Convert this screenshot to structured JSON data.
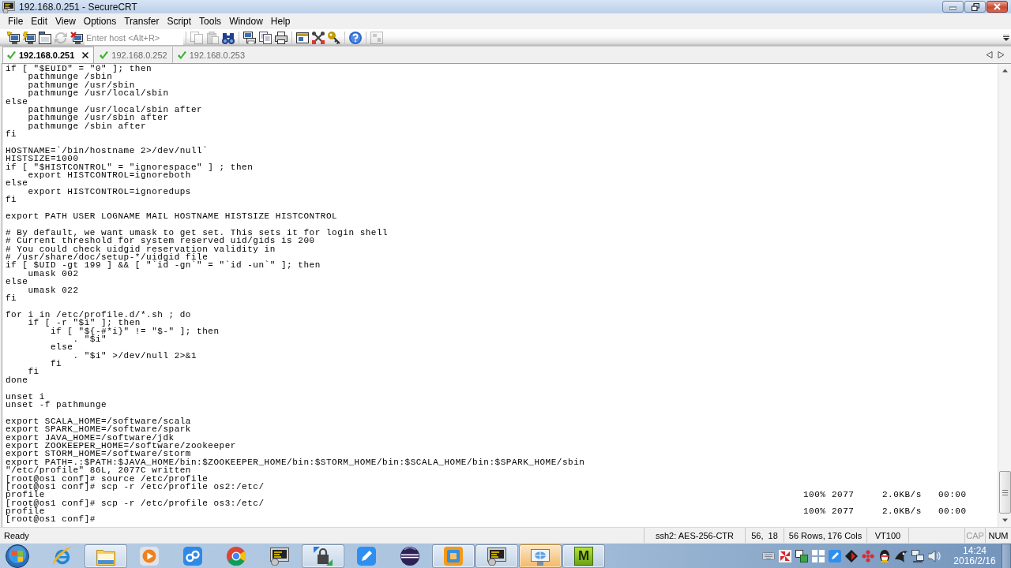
{
  "window": {
    "title": "192.168.0.251 - SecureCRT"
  },
  "menu": [
    "File",
    "Edit",
    "View",
    "Options",
    "Transfer",
    "Script",
    "Tools",
    "Window",
    "Help"
  ],
  "toolbar": {
    "connection_buttons": [
      {
        "kind": "connect",
        "disabled": false
      },
      {
        "kind": "quick",
        "disabled": false
      },
      {
        "kind": "tab",
        "disabled": false
      },
      {
        "kind": "reconnect",
        "disabled": true
      },
      {
        "kind": "disconnect",
        "disabled": false
      }
    ],
    "host_field": {
      "placeholder": "Enter host <Alt+R>"
    },
    "button_groups": [
      [
        {
          "kind": "copy",
          "disabled": true
        },
        {
          "kind": "paste",
          "disabled": true
        },
        {
          "kind": "find",
          "disabled": false
        }
      ],
      [
        {
          "kind": "setup",
          "disabled": false
        },
        {
          "kind": "pages",
          "disabled": false
        },
        {
          "kind": "print",
          "disabled": false
        }
      ],
      [
        {
          "kind": "session",
          "disabled": false
        },
        {
          "kind": "options",
          "disabled": false
        },
        {
          "kind": "keymap",
          "disabled": false
        }
      ],
      [
        {
          "kind": "help",
          "disabled": false
        }
      ],
      [
        {
          "kind": "tile",
          "disabled": true
        }
      ]
    ]
  },
  "tabs": [
    {
      "label": "192.168.0.251",
      "selected": true,
      "connected": true
    },
    {
      "label": "192.168.0.252",
      "selected": false,
      "connected": true
    },
    {
      "label": "192.168.0.253",
      "selected": false,
      "connected": true
    }
  ],
  "terminal": {
    "blocks": [
      [
        {
          "kind": "text",
          "text": "if [ \"$EUID\" = \"0\" ]; then"
        },
        {
          "kind": "text",
          "text": "    pathmunge /sbin"
        },
        {
          "kind": "text",
          "text": "    pathmunge /usr/sbin"
        },
        {
          "kind": "text",
          "text": "    pathmunge /usr/local/sbin"
        },
        {
          "kind": "text",
          "text": "else"
        },
        {
          "kind": "text",
          "text": "    pathmunge /usr/local/sbin after"
        },
        {
          "kind": "text",
          "text": "    pathmunge /usr/sbin after"
        },
        {
          "kind": "text",
          "text": "    pathmunge /sbin after"
        },
        {
          "kind": "text",
          "text": "fi"
        }
      ],
      [
        {
          "kind": "text",
          "text": "HOSTNAME=`/bin/hostname 2>/dev/null`"
        },
        {
          "kind": "text",
          "text": "HISTSIZE=1000"
        },
        {
          "kind": "text",
          "text": "if [ \"$HISTCONTROL\" = \"ignorespace\" ] ; then"
        },
        {
          "kind": "text",
          "text": "    export HISTCONTROL=ignoreboth"
        },
        {
          "kind": "text",
          "text": "else"
        },
        {
          "kind": "text",
          "text": "    export HISTCONTROL=ignoredups"
        },
        {
          "kind": "text",
          "text": "fi"
        }
      ],
      [
        {
          "kind": "text",
          "text": "export PATH USER LOGNAME MAIL HOSTNAME HISTSIZE HISTCONTROL"
        }
      ],
      [
        {
          "kind": "text",
          "text": "# By default, we want umask to get set. This sets it for login shell"
        },
        {
          "kind": "text",
          "text": "# Current threshold for system reserved uid/gids is 200"
        },
        {
          "kind": "text",
          "text": "# You could check uidgid reservation validity in"
        },
        {
          "kind": "text",
          "text": "# /usr/share/doc/setup-*/uidgid file"
        },
        {
          "kind": "text",
          "text": "if [ $UID -gt 199 ] && [ \"`id -gn`\" = \"`id -un`\" ]; then"
        },
        {
          "kind": "text",
          "text": "    umask 002"
        },
        {
          "kind": "text",
          "text": "else"
        },
        {
          "kind": "text",
          "text": "    umask 022"
        },
        {
          "kind": "text",
          "text": "fi"
        }
      ],
      [
        {
          "kind": "text",
          "text": "for i in /etc/profile.d/*.sh ; do"
        },
        {
          "kind": "text",
          "text": "    if [ -r \"$i\" ]; then"
        },
        {
          "kind": "text",
          "text": "        if [ \"${-#*i}\" != \"$-\" ]; then"
        },
        {
          "kind": "text",
          "text": "            . \"$i\""
        },
        {
          "kind": "text",
          "text": "        else"
        },
        {
          "kind": "text",
          "text": "            . \"$i\" >/dev/null 2>&1"
        },
        {
          "kind": "text",
          "text": "        fi"
        },
        {
          "kind": "text",
          "text": "    fi"
        },
        {
          "kind": "text",
          "text": "done"
        }
      ],
      [
        {
          "kind": "text",
          "text": "unset i"
        },
        {
          "kind": "text",
          "text": "unset -f pathmunge"
        }
      ],
      [
        {
          "kind": "text",
          "text": "export SCALA_HOME=/software/scala"
        },
        {
          "kind": "text",
          "text": "export SPARK_HOME=/software/spark"
        },
        {
          "kind": "text",
          "text": "export JAVA_HOME=/software/jdk"
        },
        {
          "kind": "text",
          "text": "export ZOOKEEPER_HOME=/software/zookeeper"
        },
        {
          "kind": "text",
          "text": "export STORM_HOME=/software/storm"
        },
        {
          "kind": "text",
          "text": "export PATH=.:$PATH:$JAVA_HOME/bin:$ZOOKEEPER_HOME/bin:$STORM_HOME/bin:$SCALA_HOME/bin:$SPARK_HOME/sbin"
        },
        {
          "kind": "text",
          "text": "\"/etc/profile\" 86L, 2077C written"
        },
        {
          "kind": "text",
          "text": "[root@os1 conf]# source /etc/profile"
        },
        {
          "kind": "text",
          "text": "[root@os1 conf]# scp -r /etc/profile os2:/etc/"
        },
        {
          "kind": "transfer",
          "file": "profile",
          "percent": "100%",
          "size": "2077",
          "rate": "2.0KB/s",
          "time": "00:00"
        },
        {
          "kind": "text",
          "text": "[root@os1 conf]# scp -r /etc/profile os3:/etc/"
        },
        {
          "kind": "transfer",
          "file": "profile",
          "percent": "100%",
          "size": "2077",
          "rate": "2.0KB/s",
          "time": "00:00"
        },
        {
          "kind": "text",
          "text": "[root@os1 conf]#"
        }
      ]
    ]
  },
  "status_bar": {
    "message": "Ready",
    "cipher": "ssh2: AES-256-CTR",
    "cursor": "56,  18",
    "size": "56 Rows, 176 Cols",
    "emulation": "VT100",
    "indicators": [
      {
        "label": "CAP",
        "on": false
      },
      {
        "label": "NUM",
        "on": true
      }
    ]
  },
  "taskbar": {
    "items": [
      {
        "kind": "browser",
        "open": false,
        "highlighted": false
      },
      {
        "kind": "folder",
        "open": true,
        "highlighted": false
      },
      {
        "kind": "player",
        "open": false,
        "highlighted": false
      },
      {
        "kind": "cloud",
        "open": false,
        "highlighted": false
      },
      {
        "kind": "wheel",
        "open": false,
        "highlighted": false
      },
      {
        "kind": "terminal",
        "open": false,
        "highlighted": false
      },
      {
        "kind": "lock",
        "open": true,
        "highlighted": false
      },
      {
        "kind": "pen",
        "open": false,
        "highlighted": false
      },
      {
        "kind": "sphere",
        "open": false,
        "highlighted": false
      },
      {
        "kind": "frame",
        "open": true,
        "highlighted": false
      },
      {
        "kind": "terminal",
        "open": true,
        "highlighted": false
      },
      {
        "kind": "network",
        "open": true,
        "highlighted": true
      },
      {
        "kind": "letter",
        "open": true,
        "highlighted": false,
        "label": "M"
      }
    ],
    "clock": {
      "time": "14:24",
      "date": "2016/2/16"
    }
  }
}
